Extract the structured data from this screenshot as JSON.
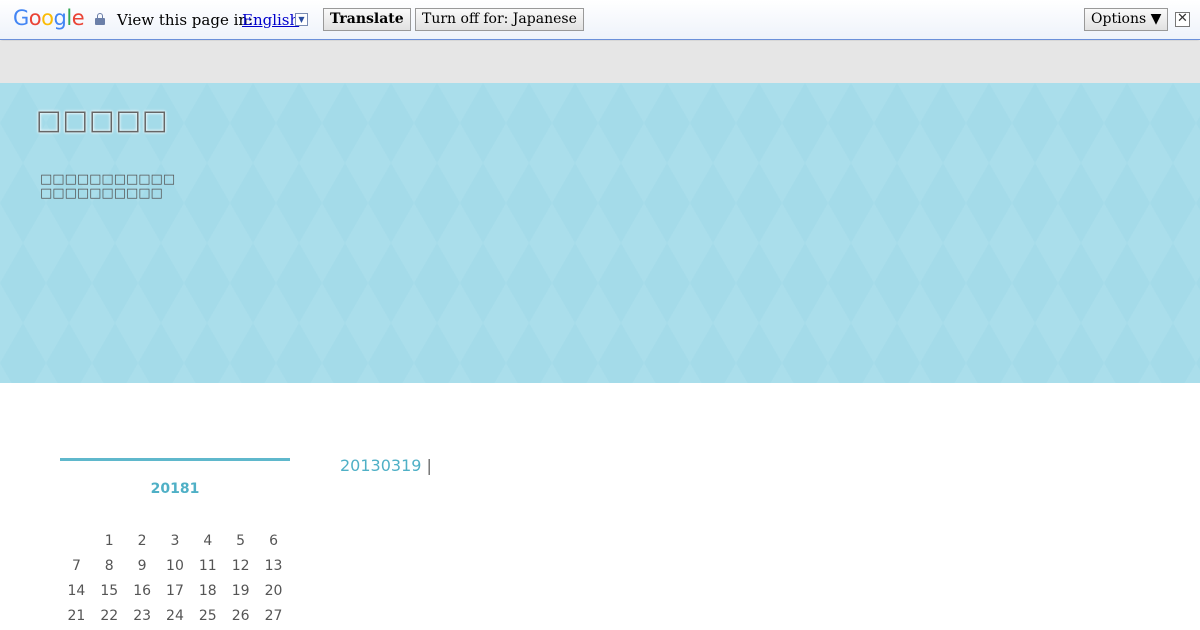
{
  "translate_bar": {
    "logo_letters": [
      "G",
      "o",
      "o",
      "g",
      "l",
      "e"
    ],
    "view_text": "View this page in:",
    "language": "English",
    "language_arrow": "▼",
    "translate_label": "Translate",
    "turn_off_label": "Turn off for: Japanese",
    "options_label": "Options ▼",
    "close_label": "✕",
    "colors": {
      "border": "#6b90da",
      "link": "#0000cc"
    }
  },
  "header": {
    "site_title": "□□□□□",
    "description_lines": [
      "□□□□□□□□□□□",
      "□□□□□□□□□□"
    ],
    "background_color": "#a4dbe9"
  },
  "calendar": {
    "title": "20181",
    "rows": [
      [
        "",
        "1",
        "2",
        "3",
        "4",
        "5",
        "6"
      ],
      [
        "7",
        "8",
        "9",
        "10",
        "11",
        "12",
        "13"
      ],
      [
        "14",
        "15",
        "16",
        "17",
        "18",
        "19",
        "20"
      ],
      [
        "21",
        "22",
        "23",
        "24",
        "25",
        "26",
        "27"
      ]
    ],
    "accent_color": "#4fb0c6"
  },
  "post": {
    "date": "20130319",
    "separator": "|"
  }
}
